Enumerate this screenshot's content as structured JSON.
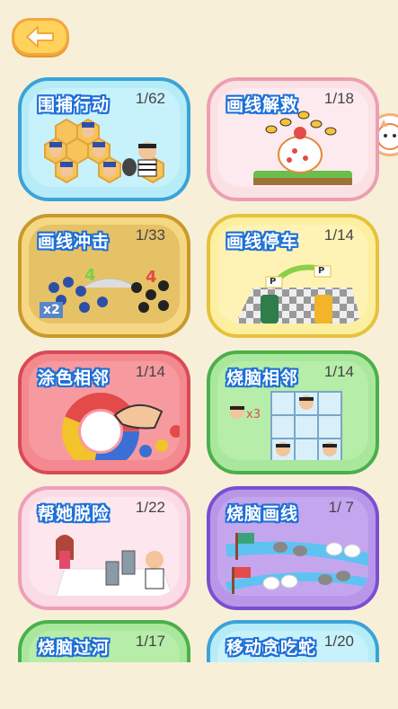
{
  "header": {
    "back_label": ""
  },
  "games": [
    {
      "title": "围捕行动",
      "count": "1/62"
    },
    {
      "title": "画线解救",
      "count": "1/18"
    },
    {
      "title": "画线冲击",
      "count": "1/33"
    },
    {
      "title": "画线停车",
      "count": "1/14"
    },
    {
      "title": "涂色相邻",
      "count": "1/14"
    },
    {
      "title": "烧脑相邻",
      "count": "1/14"
    },
    {
      "title": "帮她脱险",
      "count": "1/22"
    },
    {
      "title": "烧脑画线",
      "count": "1/ 7"
    },
    {
      "title": "烧脑过河",
      "count": "1/17"
    },
    {
      "title": "移动贪吃蛇",
      "count": "1/20"
    }
  ],
  "art_labels": {
    "x2": "x2",
    "four_a": "4",
    "four_b": "4",
    "x3": "x3",
    "p1": "P",
    "p2": "P"
  },
  "colors": {
    "background": "#f8efd9",
    "back_button": "#ffd25c",
    "title_outline": "#1d6fd6"
  }
}
